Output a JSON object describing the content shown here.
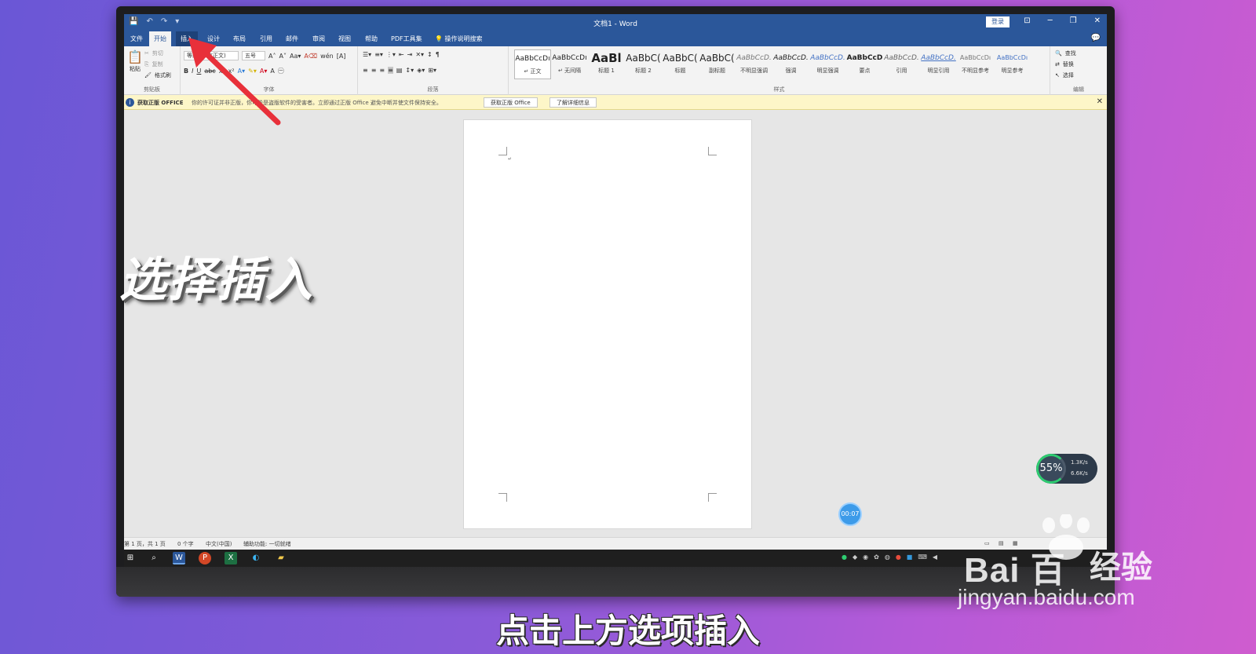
{
  "titlebar": {
    "doc_title": "文档1 - Word",
    "login": "登录",
    "qat": [
      "💾",
      "↶",
      "↷",
      "▾"
    ],
    "controls": [
      "⊡",
      "─",
      "❐",
      "✕"
    ]
  },
  "tabs": [
    "文件",
    "开始",
    "插入",
    "设计",
    "布局",
    "引用",
    "邮件",
    "审阅",
    "视图",
    "帮助",
    "PDF工具集"
  ],
  "tell_me": "操作说明搜索",
  "ribbon": {
    "clipboard": {
      "paste": "粘贴",
      "cut": "剪切",
      "copy": "复制",
      "format_painter": "格式刷",
      "label": "剪贴板"
    },
    "font": {
      "font_name": "等线 (中文正文)",
      "font_size": "五号",
      "label": "字体"
    },
    "paragraph": {
      "label": "段落"
    },
    "styles": {
      "label": "样式",
      "items": [
        {
          "preview": "AaBbCcDı",
          "name": "↵ 正文"
        },
        {
          "preview": "AaBbCcDı",
          "name": "↵ 无间隔"
        },
        {
          "preview": "AaBl",
          "name": "标题 1"
        },
        {
          "preview": "AaBbC(",
          "name": "标题 2"
        },
        {
          "preview": "AaBbC(",
          "name": "标题"
        },
        {
          "preview": "AaBbC(",
          "name": "副标题"
        },
        {
          "preview": "AaBbCcD.",
          "name": "不明显强调"
        },
        {
          "preview": "AaBbCcD.",
          "name": "强调"
        },
        {
          "preview": "AaBbCcD.",
          "name": "明显强调"
        },
        {
          "preview": "AaBbCcD",
          "name": "要点"
        },
        {
          "preview": "AaBbCcD.",
          "name": "引用"
        },
        {
          "preview": "AaBbCcD.",
          "name": "明显引用"
        },
        {
          "preview": "AaBbCcDı",
          "name": "不明显参考"
        },
        {
          "preview": "AaBbCcDı",
          "name": "明显参考"
        }
      ]
    },
    "editing": {
      "find": "查找",
      "replace": "替换",
      "select": "选择",
      "label": "编辑"
    }
  },
  "banner": {
    "title": "获取正版 OFFICE",
    "message": "你的许可证并非正版，你可能是盗版软件的受害者。立即通过正版 Office 避免中断并使文件保持安全。",
    "btn_get": "获取正版 Office",
    "btn_learn": "了解详细信息"
  },
  "statusbar": {
    "page": "第 1 页，共 1 页",
    "words": "0 个字",
    "lang": "中文(中国)",
    "accessibility": "辅助功能: 一切就绪"
  },
  "overlay": {
    "speed_percent": "55%",
    "upload": "1.3K/s",
    "download": "6.6K/s",
    "timer": "00:07",
    "side_caption": "选择插入",
    "subtitle": "点击上方选项插入",
    "watermark_logo": "Bai 百",
    "watermark_jingyan": "经验",
    "watermark_url": "jingyan.baidu.com"
  },
  "colors": {
    "word_blue": "#2b579a",
    "arrow_red": "#e8303a",
    "banner_yellow": "#fdf6c8"
  }
}
